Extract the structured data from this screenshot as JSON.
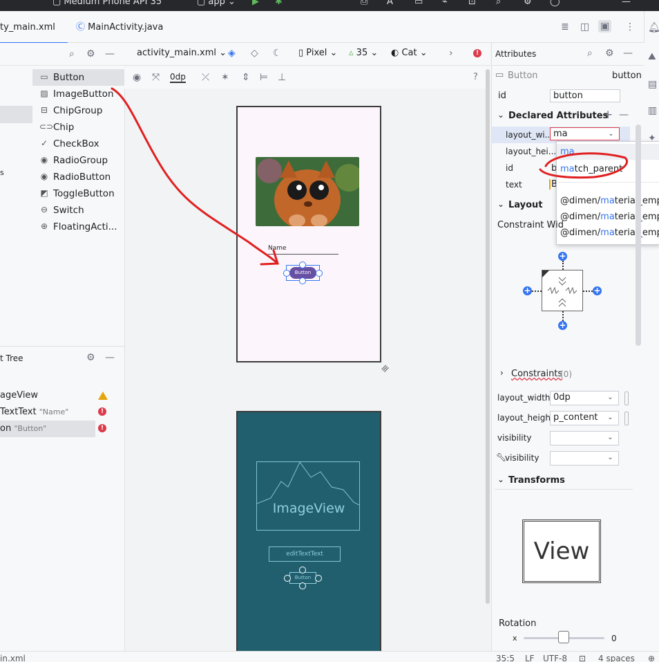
{
  "topbar": {
    "device": "Medium Phone API 35",
    "run_config": "app"
  },
  "tabs": [
    {
      "label": "ty_main.xml",
      "active": true
    },
    {
      "label": "MainActivity.java",
      "active": false
    }
  ],
  "palette": {
    "items": [
      {
        "icon": "button-icon",
        "label": "Button",
        "selected": true
      },
      {
        "icon": "image-button-icon",
        "label": "ImageButton"
      },
      {
        "icon": "chip-group-icon",
        "label": "ChipGroup"
      },
      {
        "icon": "chip-icon",
        "label": "Chip"
      },
      {
        "icon": "checkbox-icon",
        "label": "CheckBox"
      },
      {
        "icon": "radio-group-icon",
        "label": "RadioGroup"
      },
      {
        "icon": "radio-button-icon",
        "label": "RadioButton"
      },
      {
        "icon": "toggle-button-icon",
        "label": "ToggleButton"
      },
      {
        "icon": "switch-icon",
        "label": "Switch"
      },
      {
        "icon": "fab-icon",
        "label": "FloatingActi..."
      }
    ],
    "cat_fragment": "s"
  },
  "component_tree": {
    "title": "t Tree",
    "rows": [
      {
        "label": "ageView",
        "hint": "",
        "status": "warning"
      },
      {
        "label": "TextText",
        "hint": "\"Name\"",
        "status": "error"
      },
      {
        "label": "on",
        "hint": "\"Button\"",
        "status": "error",
        "selected": true
      }
    ]
  },
  "design_toolbar": {
    "file": "activity_main.xml",
    "device": "Pixel",
    "api": "35",
    "theme": "Cat",
    "margin": "0dp",
    "help": "?"
  },
  "preview": {
    "name_label": "Name",
    "button_label": "Button",
    "blueprint_image_label": "ImageView",
    "blueprint_edit_label": "editTextText",
    "blueprint_button_label": "Button"
  },
  "attributes": {
    "title": "Attributes",
    "widget_type": "Button",
    "widget_id": "button",
    "id_label": "id",
    "id_value": "button",
    "declared_title": "Declared Attributes",
    "declared_rows": [
      {
        "key": "layout_wi...",
        "value": "ma"
      },
      {
        "key": "layout_hei...",
        "value": ""
      },
      {
        "key": "id",
        "value": "b"
      },
      {
        "key": "text",
        "value": "B"
      }
    ],
    "autocomplete": [
      {
        "prefix": "ma",
        "rest": ""
      },
      {
        "prefix": "ma",
        "rest": "tch_parent",
        "before": ""
      },
      {
        "before": "@dimen/",
        "prefix": "ma",
        "rest": "terial_empha"
      },
      {
        "before": "@dimen/",
        "prefix": "ma",
        "rest": "terial_empha"
      },
      {
        "before": "@dimen/",
        "prefix": "ma",
        "rest": "terial_empha"
      }
    ],
    "layout_title": "Layout",
    "constraint_label": "Constraint Wid",
    "constraints_label": "Constraints",
    "constraints_count": "(0)",
    "layout_width_label": "layout_width",
    "layout_width_value": "0dp",
    "layout_height_label": "layout_height",
    "layout_height_value": "p_content",
    "visibility_label": "visibility",
    "tools_visibility_label": "visibility",
    "transforms_title": "Transforms",
    "view_label": "View",
    "rotation_label": "Rotation",
    "rotation_axis": "x",
    "rotation_value": "0"
  },
  "statusbar": {
    "file": "in.xml",
    "position": "35:5",
    "line_ending": "LF",
    "encoding": "UTF-8",
    "indent": "4 spaces"
  },
  "colors": {
    "accent": "#3574f0",
    "button_fill": "#6750a4",
    "blueprint_bg": "#215f6f",
    "annotation_red": "#e02020"
  }
}
